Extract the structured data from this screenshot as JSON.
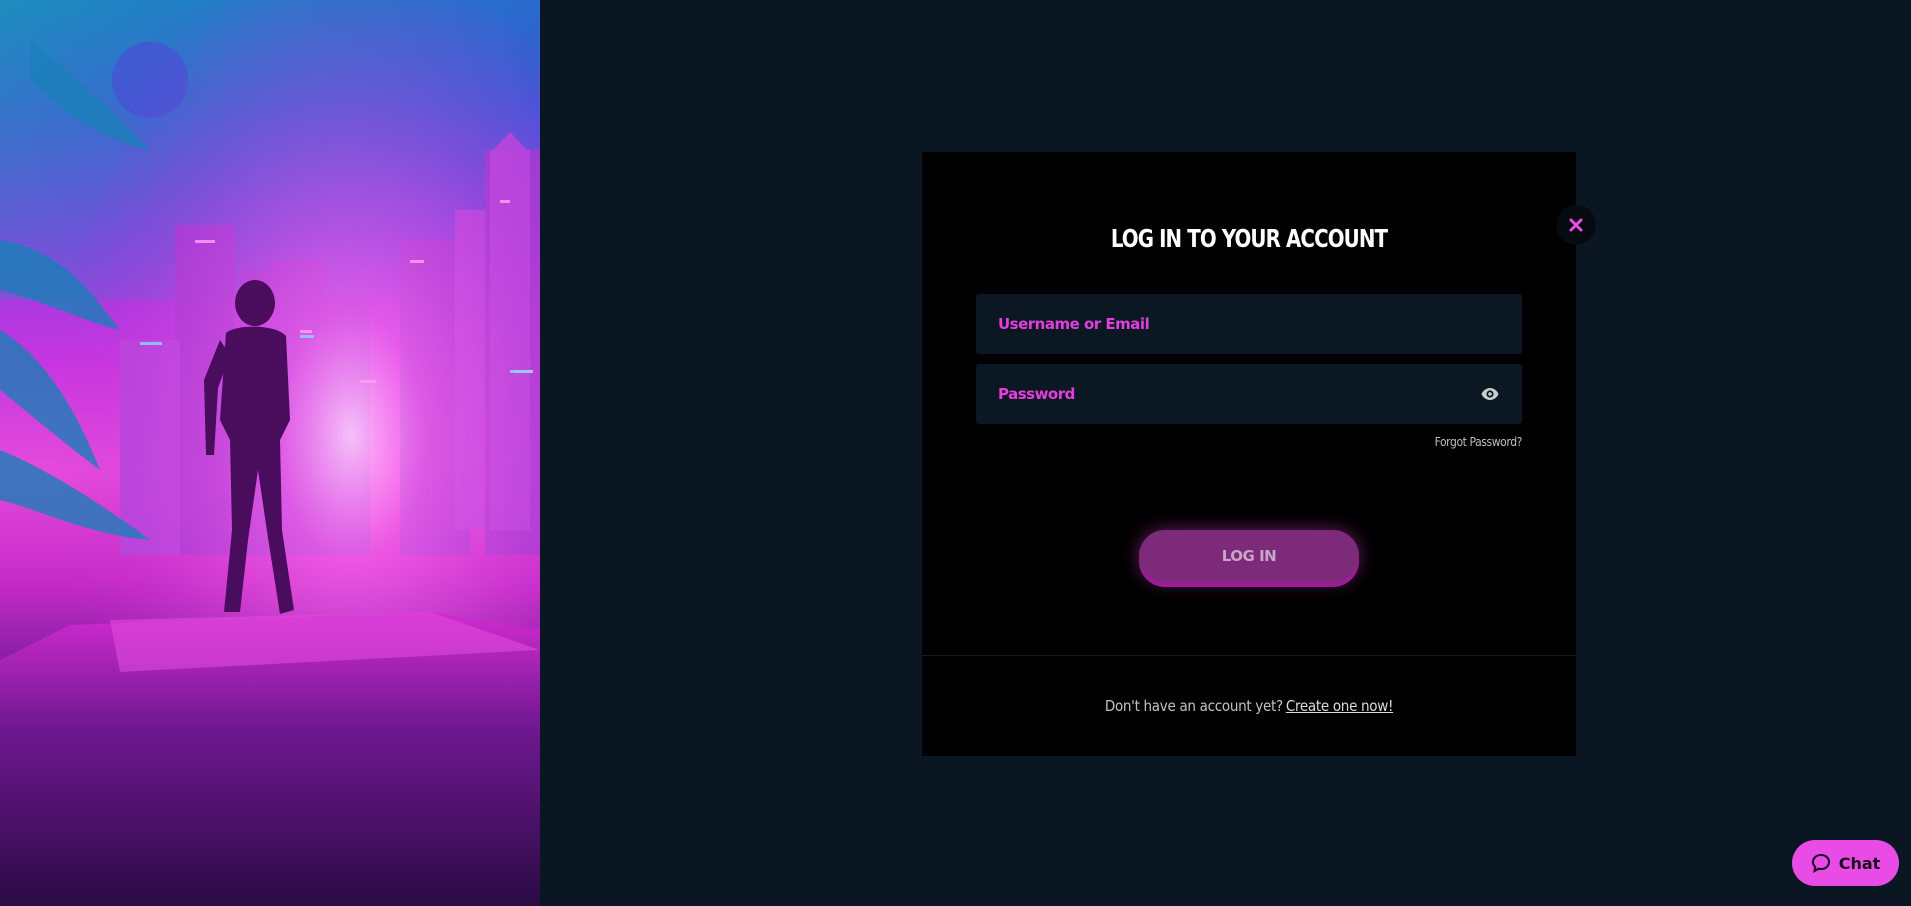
{
  "login": {
    "title": "LOG IN TO YOUR ACCOUNT",
    "username_placeholder": "Username or Email",
    "password_placeholder": "Password",
    "forgot_password": "Forgot Password?",
    "submit_label": "LOG IN",
    "footer_text": "Don't have an account yet?",
    "footer_link": "Create one now!"
  },
  "icons": {
    "close": "close-icon",
    "password_visibility": "eye-icon",
    "chat": "chat-bubble-icon"
  },
  "chat": {
    "label": "Chat"
  },
  "colors": {
    "accent": "#e94ce6",
    "page_background": "#0a1722",
    "modal_background": "#000000",
    "input_background": "#0b1823"
  }
}
